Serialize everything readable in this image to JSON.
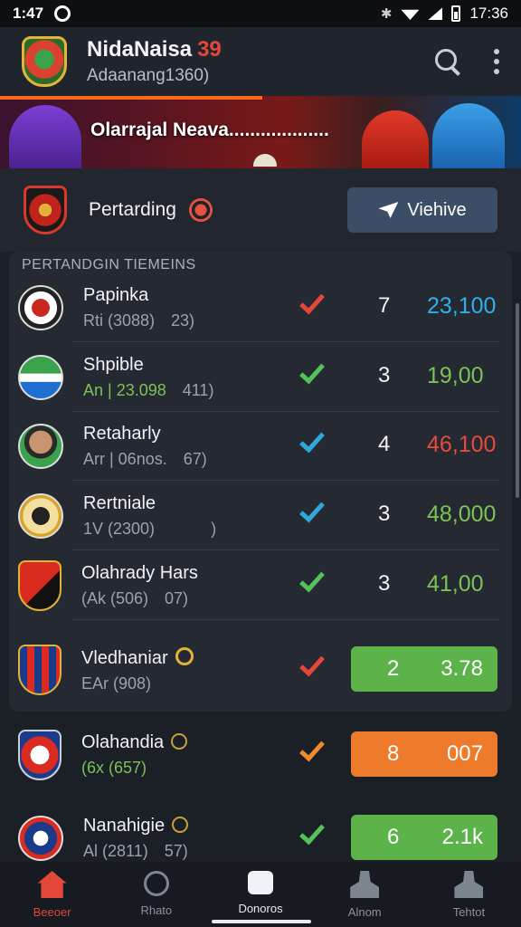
{
  "status_bar": {
    "time_left": "1:47",
    "time_right": "17:36"
  },
  "header": {
    "title": "NidaNaisa",
    "title_number": "39",
    "subtitle": "Adaanang1360)"
  },
  "hero": {
    "text": "Olarrajal Neava..................."
  },
  "match": {
    "label": "Pertarding",
    "button_label": "Viehive"
  },
  "list": {
    "header": "PERTANDGIN TIEMEINS",
    "rows": [
      {
        "name": "Papinka",
        "meta_a": "Rti (3088)",
        "meta_b": "23)",
        "rank": "7",
        "score": "23,100",
        "check": "red",
        "score_color": "blue"
      },
      {
        "name": "Shpible",
        "meta_a": "An | 23.098",
        "meta_b": "411)",
        "rank": "3",
        "score": "19,00",
        "check": "green",
        "score_color": "green"
      },
      {
        "name": "Retaharly",
        "meta_a": "Arr | 06nos.",
        "meta_b": "67)",
        "rank": "4",
        "score": "46,100",
        "check": "blue",
        "score_color": "red"
      },
      {
        "name": "Rertniale",
        "meta_a": "1V (2300)",
        "meta_b": ")",
        "rank": "3",
        "score": "48,000",
        "check": "blue",
        "score_color": "green"
      },
      {
        "name": "Olahrady Hars",
        "meta_a": "(Ak (506)",
        "meta_b": "07)",
        "rank": "3",
        "score": "41,00",
        "check": "green",
        "score_color": "green"
      },
      {
        "name": "Vledhaniar",
        "meta_a": "EAr (908)",
        "meta_b": "",
        "rank": "2",
        "score": "3.78",
        "check": "red",
        "pill": "green"
      },
      {
        "name": "Olahandia",
        "meta_a": "(6x (657)",
        "meta_b": "",
        "rank": "8",
        "score": "007",
        "check": "orange",
        "pill": "orange"
      },
      {
        "name": "Nanahigie",
        "meta_a": "Al (2811)",
        "meta_b": "57)",
        "rank": "6",
        "score": "2.1k",
        "check": "green",
        "pill": "green"
      }
    ]
  },
  "bottom_nav": {
    "items": [
      {
        "label": "Beeoer",
        "icon": "home-icon"
      },
      {
        "label": "Rhato",
        "icon": "ball-icon"
      },
      {
        "label": "Donoros",
        "icon": "whistle-icon"
      },
      {
        "label": "Alnom",
        "icon": "person-icon"
      },
      {
        "label": "Tehtot",
        "icon": "person-icon"
      }
    ]
  },
  "colors": {
    "accent": "#e2473a",
    "green": "#5cb34a",
    "orange": "#ee7a2c",
    "blue": "#2fb0e8",
    "background": "#1b1f26"
  }
}
